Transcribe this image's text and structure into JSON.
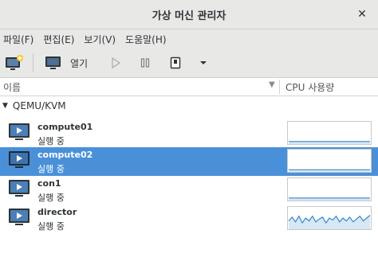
{
  "window": {
    "title": "가상 머신 관리자",
    "close_icon": "close-icon"
  },
  "menubar": {
    "items": [
      {
        "label": "파일(F)"
      },
      {
        "label": "편집(E)"
      },
      {
        "label": "보기(V)"
      },
      {
        "label": "도움말(H)"
      }
    ]
  },
  "toolbar": {
    "new_vm_icon": "new-vm-icon",
    "open_label": "열기",
    "run_icon": "play-icon",
    "pause_icon": "pause-icon",
    "shutdown_icon": "shutdown-icon",
    "dropdown_icon": "chevron-down-icon"
  },
  "columns": {
    "name": "이름",
    "cpu": "CPU 사용량"
  },
  "connection": {
    "label": "QEMU/KVM",
    "expanded": true
  },
  "vms": [
    {
      "name": "compute01",
      "status": "실행 중",
      "selected": false,
      "cpu": [
        0.05,
        0.05,
        0.05,
        0.05,
        0.05,
        0.05,
        0.05,
        0.05,
        0.05,
        0.05,
        0.05,
        0.05,
        0.05,
        0.05,
        0.05,
        0.05,
        0.05,
        0.05,
        0.05,
        0.05,
        0.05,
        0.05,
        0.05,
        0.05,
        0.05
      ]
    },
    {
      "name": "compute02",
      "status": "실행 중",
      "selected": true,
      "cpu": [
        0.03,
        0.03,
        0.03,
        0.03,
        0.03,
        0.03,
        0.03,
        0.03,
        0.03,
        0.03,
        0.03,
        0.03,
        0.03,
        0.03,
        0.03,
        0.03,
        0.03,
        0.03,
        0.03,
        0.03,
        0.03,
        0.03,
        0.03,
        0.03,
        0.03
      ]
    },
    {
      "name": "con1",
      "status": "실행 중",
      "selected": false,
      "cpu": [
        0.05,
        0.05,
        0.05,
        0.05,
        0.05,
        0.05,
        0.05,
        0.05,
        0.05,
        0.05,
        0.05,
        0.05,
        0.05,
        0.05,
        0.05,
        0.05,
        0.05,
        0.05,
        0.05,
        0.05,
        0.05,
        0.05,
        0.05,
        0.05,
        0.05
      ]
    },
    {
      "name": "director",
      "status": "실행 중",
      "selected": false,
      "cpu": [
        0.35,
        0.55,
        0.3,
        0.6,
        0.25,
        0.5,
        0.35,
        0.6,
        0.3,
        0.45,
        0.55,
        0.25,
        0.5,
        0.4,
        0.6,
        0.3,
        0.5,
        0.35,
        0.55,
        0.3,
        0.45,
        0.6,
        0.35,
        0.5,
        0.65
      ]
    }
  ],
  "colors": {
    "selection": "#4a90d9",
    "graph_line": "#3b86c7",
    "graph_fill": "#d6e7f6"
  }
}
